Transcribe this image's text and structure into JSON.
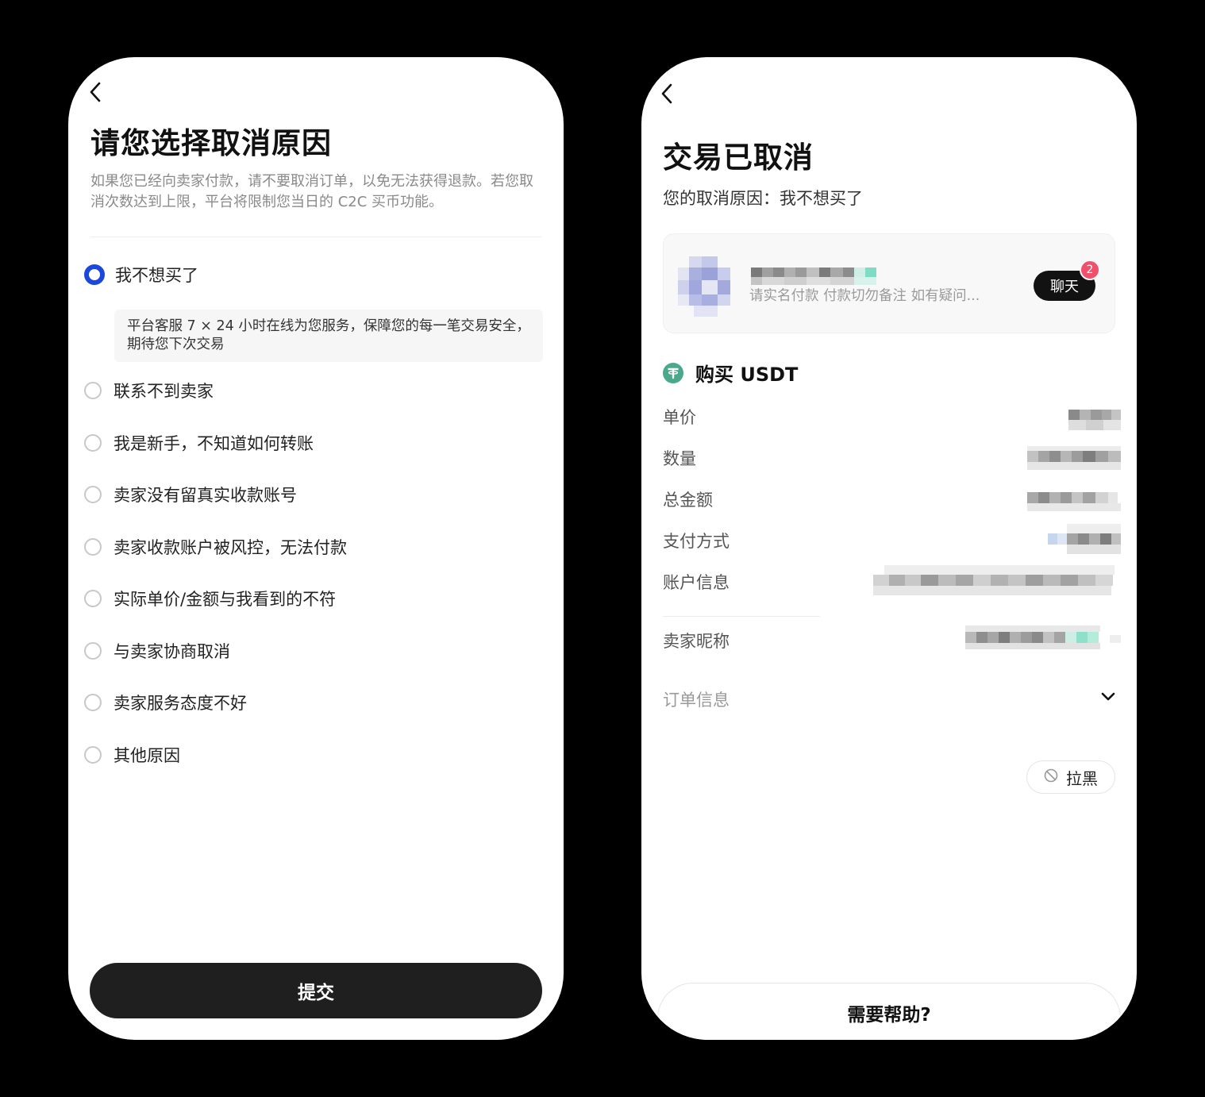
{
  "left": {
    "title": "请您选择取消原因",
    "description": "如果您已经向卖家付款，请不要取消订单，以免无法获得退款。若您取消次数达到上限，平台将限制您当日的 C2C 买币功能。",
    "selected_hint": "平台客服 7 × 24 小时在线为您服务，保障您的每一笔交易安全，期待您下次交易",
    "options": [
      {
        "label": "我不想买了",
        "selected": true
      },
      {
        "label": "联系不到卖家",
        "selected": false
      },
      {
        "label": "我是新手，不知道如何转账",
        "selected": false
      },
      {
        "label": "卖家没有留真实收款账号",
        "selected": false
      },
      {
        "label": "卖家收款账户被风控，无法付款",
        "selected": false
      },
      {
        "label": "实际单价/金额与我看到的不符",
        "selected": false
      },
      {
        "label": "与卖家协商取消",
        "selected": false
      },
      {
        "label": "卖家服务态度不好",
        "selected": false
      },
      {
        "label": "其他原因",
        "selected": false
      }
    ],
    "submit_label": "提交"
  },
  "right": {
    "title": "交易已取消",
    "cancel_reason": "您的取消原因：我不想买了",
    "seller_card": {
      "message": "请实名付款 付款切勿备注 如有疑问...",
      "chat_label": "聊天",
      "unread_count": "2"
    },
    "buy_label": "购买 USDT",
    "fields": {
      "unit_price": "单价",
      "quantity": "数量",
      "total_amount": "总金额",
      "payment_method": "支付方式",
      "account_info": "账户信息",
      "seller_nickname": "卖家昵称"
    },
    "order_info_label": "订单信息",
    "block_label": "拉黑",
    "help_label": "需要帮助?"
  },
  "colors": {
    "radio_selected": "#1c47dc",
    "primary_button": "#1f1f1f",
    "badge": "#f0506c",
    "usdt": "#4aa88c"
  },
  "icons": [
    "back-arrow-icon",
    "usdt-icon",
    "chevron-down-icon",
    "block-icon"
  ]
}
